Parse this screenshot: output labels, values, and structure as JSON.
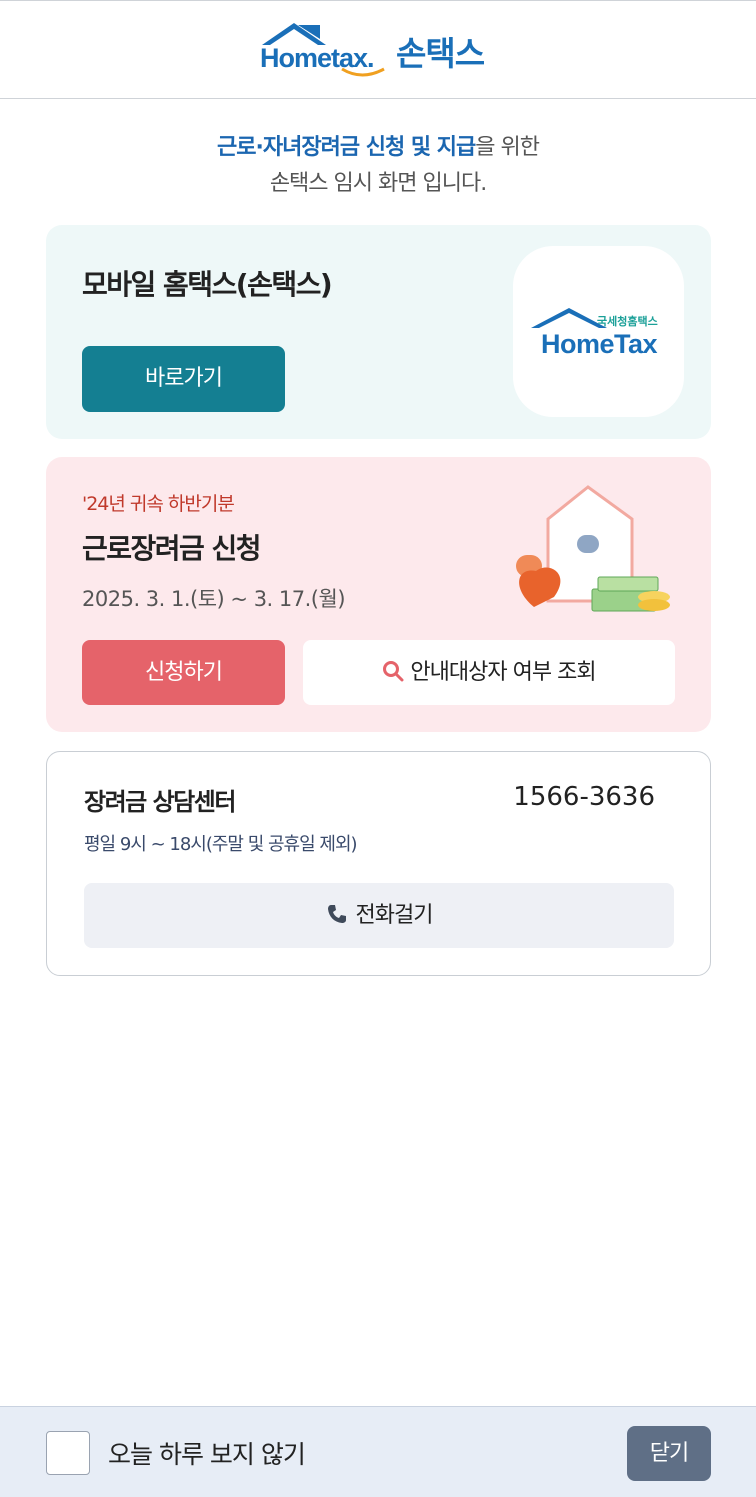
{
  "header": {
    "logo_text": "Hometax.",
    "logo_son": "손택스"
  },
  "intro": {
    "highlight": "근로·자녀장려금 신청 및 지급",
    "line1_rest": "을 위한",
    "line2": "손택스 임시 화면 입니다."
  },
  "mobile_card": {
    "title": "모바일 홈택스(손택스)",
    "button_label": "바로가기",
    "app_logo_small": "국세청홈택스",
    "app_logo_main": "HomeTax"
  },
  "apply_card": {
    "subtitle": "'24년 귀속 하반기분",
    "title": "근로장려금 신청",
    "period": "2025. 3. 1.(토) ~ 3. 17.(월)",
    "apply_button": "신청하기",
    "lookup_button": "안내대상자 여부 조회"
  },
  "center_card": {
    "title": "장려금 상담센터",
    "phone": "1566-3636",
    "hours": "평일 9시 ~ 18시(주말 및 공휴일 제외)",
    "call_button": "전화걸기"
  },
  "footer": {
    "checkbox_label": "오늘 하루 보지 않기",
    "close_button": "닫기"
  },
  "colors": {
    "brand_blue": "#1b66b0",
    "teal": "#147f92",
    "coral": "#e5636a",
    "pink_bg": "#fde9ec",
    "mint_bg": "#eef8f8",
    "close_btn": "#5f6f86"
  }
}
